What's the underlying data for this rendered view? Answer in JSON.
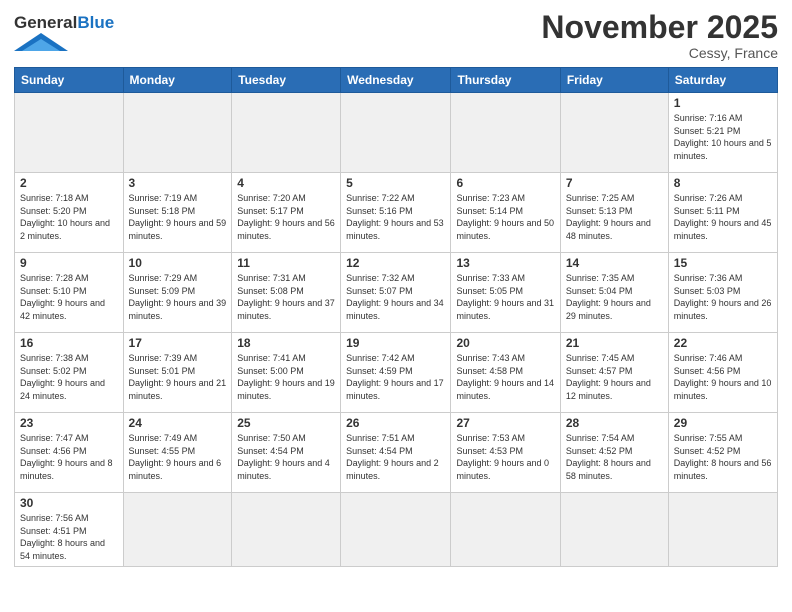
{
  "header": {
    "logo_general": "General",
    "logo_blue": "Blue",
    "month_title": "November 2025",
    "location": "Cessy, France"
  },
  "weekdays": [
    "Sunday",
    "Monday",
    "Tuesday",
    "Wednesday",
    "Thursday",
    "Friday",
    "Saturday"
  ],
  "days": {
    "1": {
      "sunrise": "Sunrise: 7:16 AM",
      "sunset": "Sunset: 5:21 PM",
      "daylight": "Daylight: 10 hours and 5 minutes."
    },
    "2": {
      "sunrise": "Sunrise: 7:18 AM",
      "sunset": "Sunset: 5:20 PM",
      "daylight": "Daylight: 10 hours and 2 minutes."
    },
    "3": {
      "sunrise": "Sunrise: 7:19 AM",
      "sunset": "Sunset: 5:18 PM",
      "daylight": "Daylight: 9 hours and 59 minutes."
    },
    "4": {
      "sunrise": "Sunrise: 7:20 AM",
      "sunset": "Sunset: 5:17 PM",
      "daylight": "Daylight: 9 hours and 56 minutes."
    },
    "5": {
      "sunrise": "Sunrise: 7:22 AM",
      "sunset": "Sunset: 5:16 PM",
      "daylight": "Daylight: 9 hours and 53 minutes."
    },
    "6": {
      "sunrise": "Sunrise: 7:23 AM",
      "sunset": "Sunset: 5:14 PM",
      "daylight": "Daylight: 9 hours and 50 minutes."
    },
    "7": {
      "sunrise": "Sunrise: 7:25 AM",
      "sunset": "Sunset: 5:13 PM",
      "daylight": "Daylight: 9 hours and 48 minutes."
    },
    "8": {
      "sunrise": "Sunrise: 7:26 AM",
      "sunset": "Sunset: 5:11 PM",
      "daylight": "Daylight: 9 hours and 45 minutes."
    },
    "9": {
      "sunrise": "Sunrise: 7:28 AM",
      "sunset": "Sunset: 5:10 PM",
      "daylight": "Daylight: 9 hours and 42 minutes."
    },
    "10": {
      "sunrise": "Sunrise: 7:29 AM",
      "sunset": "Sunset: 5:09 PM",
      "daylight": "Daylight: 9 hours and 39 minutes."
    },
    "11": {
      "sunrise": "Sunrise: 7:31 AM",
      "sunset": "Sunset: 5:08 PM",
      "daylight": "Daylight: 9 hours and 37 minutes."
    },
    "12": {
      "sunrise": "Sunrise: 7:32 AM",
      "sunset": "Sunset: 5:07 PM",
      "daylight": "Daylight: 9 hours and 34 minutes."
    },
    "13": {
      "sunrise": "Sunrise: 7:33 AM",
      "sunset": "Sunset: 5:05 PM",
      "daylight": "Daylight: 9 hours and 31 minutes."
    },
    "14": {
      "sunrise": "Sunrise: 7:35 AM",
      "sunset": "Sunset: 5:04 PM",
      "daylight": "Daylight: 9 hours and 29 minutes."
    },
    "15": {
      "sunrise": "Sunrise: 7:36 AM",
      "sunset": "Sunset: 5:03 PM",
      "daylight": "Daylight: 9 hours and 26 minutes."
    },
    "16": {
      "sunrise": "Sunrise: 7:38 AM",
      "sunset": "Sunset: 5:02 PM",
      "daylight": "Daylight: 9 hours and 24 minutes."
    },
    "17": {
      "sunrise": "Sunrise: 7:39 AM",
      "sunset": "Sunset: 5:01 PM",
      "daylight": "Daylight: 9 hours and 21 minutes."
    },
    "18": {
      "sunrise": "Sunrise: 7:41 AM",
      "sunset": "Sunset: 5:00 PM",
      "daylight": "Daylight: 9 hours and 19 minutes."
    },
    "19": {
      "sunrise": "Sunrise: 7:42 AM",
      "sunset": "Sunset: 4:59 PM",
      "daylight": "Daylight: 9 hours and 17 minutes."
    },
    "20": {
      "sunrise": "Sunrise: 7:43 AM",
      "sunset": "Sunset: 4:58 PM",
      "daylight": "Daylight: 9 hours and 14 minutes."
    },
    "21": {
      "sunrise": "Sunrise: 7:45 AM",
      "sunset": "Sunset: 4:57 PM",
      "daylight": "Daylight: 9 hours and 12 minutes."
    },
    "22": {
      "sunrise": "Sunrise: 7:46 AM",
      "sunset": "Sunset: 4:56 PM",
      "daylight": "Daylight: 9 hours and 10 minutes."
    },
    "23": {
      "sunrise": "Sunrise: 7:47 AM",
      "sunset": "Sunset: 4:56 PM",
      "daylight": "Daylight: 9 hours and 8 minutes."
    },
    "24": {
      "sunrise": "Sunrise: 7:49 AM",
      "sunset": "Sunset: 4:55 PM",
      "daylight": "Daylight: 9 hours and 6 minutes."
    },
    "25": {
      "sunrise": "Sunrise: 7:50 AM",
      "sunset": "Sunset: 4:54 PM",
      "daylight": "Daylight: 9 hours and 4 minutes."
    },
    "26": {
      "sunrise": "Sunrise: 7:51 AM",
      "sunset": "Sunset: 4:54 PM",
      "daylight": "Daylight: 9 hours and 2 minutes."
    },
    "27": {
      "sunrise": "Sunrise: 7:53 AM",
      "sunset": "Sunset: 4:53 PM",
      "daylight": "Daylight: 9 hours and 0 minutes."
    },
    "28": {
      "sunrise": "Sunrise: 7:54 AM",
      "sunset": "Sunset: 4:52 PM",
      "daylight": "Daylight: 8 hours and 58 minutes."
    },
    "29": {
      "sunrise": "Sunrise: 7:55 AM",
      "sunset": "Sunset: 4:52 PM",
      "daylight": "Daylight: 8 hours and 56 minutes."
    },
    "30": {
      "sunrise": "Sunrise: 7:56 AM",
      "sunset": "Sunset: 4:51 PM",
      "daylight": "Daylight: 8 hours and 54 minutes."
    }
  }
}
